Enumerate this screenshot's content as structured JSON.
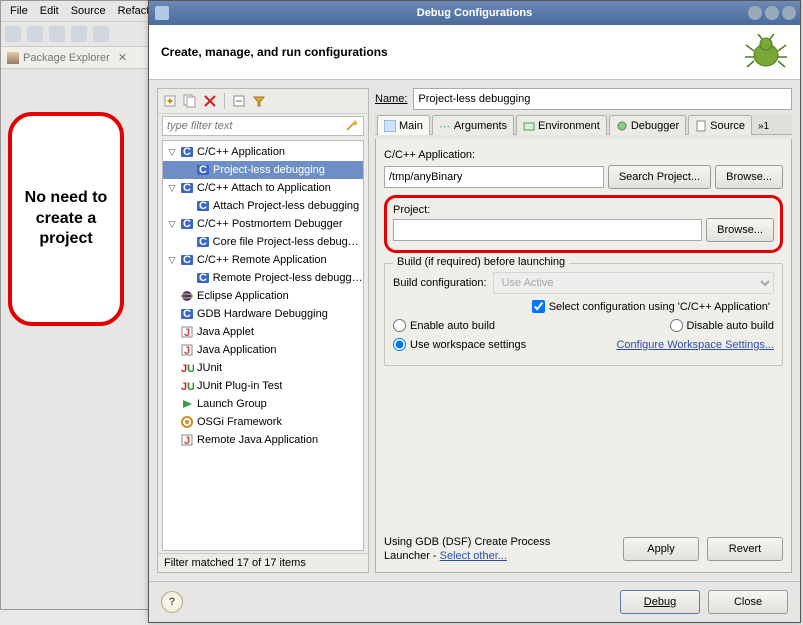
{
  "bgwin": {
    "menu": [
      "File",
      "Edit",
      "Source",
      "Refact"
    ],
    "view_tab": "Package Explorer"
  },
  "callout": "No need to create a project",
  "dialog": {
    "title": "Debug Configurations",
    "header": "Create, manage, and run configurations"
  },
  "left": {
    "filter_placeholder": "type filter text",
    "tree": [
      {
        "l": 1,
        "tw": "▽",
        "ico": "c",
        "label": "C/C++ Application"
      },
      {
        "l": 2,
        "tw": "",
        "ico": "c",
        "label": "Project-less debugging",
        "sel": true
      },
      {
        "l": 1,
        "tw": "▽",
        "ico": "c",
        "label": "C/C++ Attach to Application"
      },
      {
        "l": 2,
        "tw": "",
        "ico": "c",
        "label": "Attach Project-less debugging"
      },
      {
        "l": 1,
        "tw": "▽",
        "ico": "c",
        "label": "C/C++ Postmortem Debugger"
      },
      {
        "l": 2,
        "tw": "",
        "ico": "c",
        "label": "Core file Project-less debugging"
      },
      {
        "l": 1,
        "tw": "▽",
        "ico": "c",
        "label": "C/C++ Remote Application"
      },
      {
        "l": 2,
        "tw": "",
        "ico": "c",
        "label": "Remote Project-less debugging"
      },
      {
        "l": 1,
        "tw": "",
        "ico": "eclipse",
        "label": "Eclipse Application"
      },
      {
        "l": 1,
        "tw": "",
        "ico": "c",
        "label": "GDB Hardware Debugging"
      },
      {
        "l": 1,
        "tw": "",
        "ico": "java",
        "label": "Java Applet"
      },
      {
        "l": 1,
        "tw": "",
        "ico": "java",
        "label": "Java Application"
      },
      {
        "l": 1,
        "tw": "",
        "ico": "junit",
        "label": "JUnit"
      },
      {
        "l": 1,
        "tw": "",
        "ico": "junit",
        "label": "JUnit Plug-in Test"
      },
      {
        "l": 1,
        "tw": "",
        "ico": "launch",
        "label": "Launch Group"
      },
      {
        "l": 1,
        "tw": "",
        "ico": "osgi",
        "label": "OSGi Framework"
      },
      {
        "l": 1,
        "tw": "",
        "ico": "java",
        "label": "Remote Java Application"
      }
    ],
    "filter_status": "Filter matched 17 of 17 items"
  },
  "right": {
    "name_label": "Name:",
    "name_value": "Project-less debugging",
    "tabs": [
      "Main",
      "Arguments",
      "Environment",
      "Debugger",
      "Source"
    ],
    "tabs_more": "»1",
    "app_label": "C/C++ Application:",
    "app_value": "/tmp/anyBinary",
    "search_project": "Search Project...",
    "browse": "Browse...",
    "project_label": "Project:",
    "project_value": "",
    "build_group": {
      "title": "Build (if required) before launching",
      "config_label": "Build configuration:",
      "config_value": "Use Active",
      "select_chk": "Select configuration using 'C/C++ Application'",
      "enable_auto": "Enable auto build",
      "disable_auto": "Disable auto build",
      "use_ws": "Use workspace settings",
      "ws_link": "Configure Workspace Settings..."
    },
    "launcher_text1": "Using GDB (DSF) Create Process",
    "launcher_text2": "Launcher - ",
    "launcher_link": "Select other...",
    "apply": "Apply",
    "revert": "Revert"
  },
  "footer": {
    "debug": "Debug",
    "close": "Close"
  }
}
